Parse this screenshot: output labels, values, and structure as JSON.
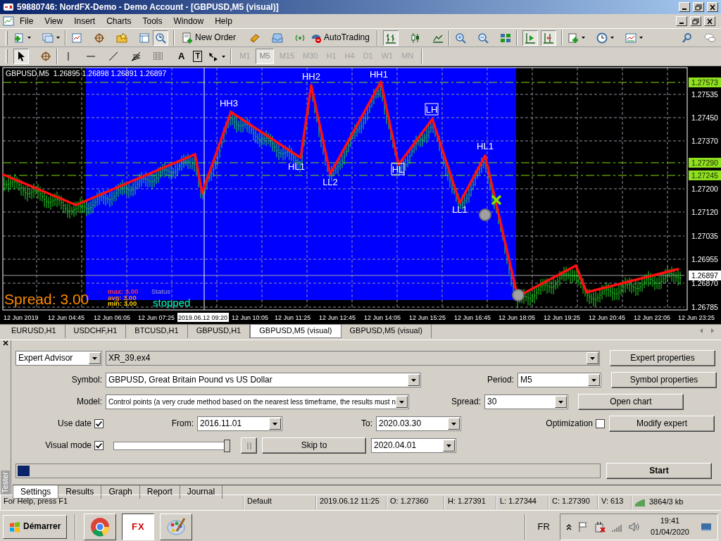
{
  "window": {
    "title": "59880746: NordFX-Demo - Demo Account - [GBPUSD,M5 (visual)]"
  },
  "menu": [
    "File",
    "View",
    "Insert",
    "Charts",
    "Tools",
    "Window",
    "Help"
  ],
  "toolbar": {
    "new_order": "New Order",
    "auto_trading": "AutoTrading"
  },
  "drawing_tools": {
    "text_tool": "A",
    "label_tool": "T"
  },
  "timeframes": [
    {
      "label": "M1",
      "selected": false
    },
    {
      "label": "M5",
      "selected": true
    },
    {
      "label": "M15",
      "selected": false
    },
    {
      "label": "M30",
      "selected": false
    },
    {
      "label": "H1",
      "selected": false
    },
    {
      "label": "H4",
      "selected": false
    },
    {
      "label": "D1",
      "selected": false
    },
    {
      "label": "W1",
      "selected": false
    },
    {
      "label": "MN",
      "selected": false
    }
  ],
  "chart": {
    "header": "GBPUSD,M5  1.26895 1.26898 1.26891 1.26897",
    "zigzag_labels": [
      {
        "text": "HH3",
        "boxed": false
      },
      {
        "text": "HH2",
        "boxed": false
      },
      {
        "text": "HH1",
        "boxed": false
      },
      {
        "text": "LH",
        "boxed": true
      },
      {
        "text": "HL1",
        "boxed": false
      },
      {
        "text": "LL2",
        "boxed": false
      },
      {
        "text": "HL",
        "boxed": true
      },
      {
        "text": "HL1",
        "boxed": false
      },
      {
        "text": "LL1",
        "boxed": false
      }
    ],
    "spread": "Spread: 3.00",
    "stats": [
      {
        "label": "max:",
        "value": "3.00",
        "color": "#ff3c3c"
      },
      {
        "label": "avg:",
        "value": "3.00",
        "color": "#ff8c00"
      },
      {
        "label": "min:",
        "value": "3.00",
        "color": "#ffd700"
      }
    ],
    "status_label": "Status",
    "status": "stopped",
    "price_labels": [
      {
        "text": "1.27573",
        "kind": "level"
      },
      {
        "text": "1.27535",
        "kind": "tick"
      },
      {
        "text": "1.27450",
        "kind": "tick"
      },
      {
        "text": "1.27370",
        "kind": "tick"
      },
      {
        "text": "1.27290",
        "kind": "level"
      },
      {
        "text": "1.27245",
        "kind": "level"
      },
      {
        "text": "1.27200",
        "kind": "tick"
      },
      {
        "text": "1.27120",
        "kind": "tick"
      },
      {
        "text": "1.27035",
        "kind": "tick"
      },
      {
        "text": "1.26955",
        "kind": "tick"
      },
      {
        "text": "1.26897",
        "kind": "bid"
      },
      {
        "text": "1.26870",
        "kind": "tick"
      },
      {
        "text": "1.26785",
        "kind": "tick"
      }
    ],
    "time_labels": [
      {
        "text": "12 Jun 2019",
        "kind": "tick"
      },
      {
        "text": "12 Jun 04:45",
        "kind": "tick"
      },
      {
        "text": "12 Jun 06:05",
        "kind": "tick"
      },
      {
        "text": "12 Jun 07:25",
        "kind": "tick"
      },
      {
        "text": "2019.06.12 09:20",
        "kind": "cursor"
      },
      {
        "text": "12 Jun 10:05",
        "kind": "tick"
      },
      {
        "text": "12 Jun 11:25",
        "kind": "tick"
      },
      {
        "text": "12 Jun 12:45",
        "kind": "tick"
      },
      {
        "text": "12 Jun 14:05",
        "kind": "tick"
      },
      {
        "text": "12 Jun 15:25",
        "kind": "tick"
      },
      {
        "text": "12 Jun 16:45",
        "kind": "tick"
      },
      {
        "text": "12 Jun 18:05",
        "kind": "tick"
      },
      {
        "text": "12 Jun 19:25",
        "kind": "tick"
      },
      {
        "text": "12 Jun 20:45",
        "kind": "tick"
      },
      {
        "text": "12 Jun 22:05",
        "kind": "tick"
      },
      {
        "text": "12 Jun 23:25",
        "kind": "tick"
      }
    ]
  },
  "chart_tabs": [
    {
      "label": "EURUSD,H1",
      "selected": false
    },
    {
      "label": "USDCHF,H1",
      "selected": false
    },
    {
      "label": "BTCUSD,H1",
      "selected": false
    },
    {
      "label": "GBPUSD,H1",
      "selected": false
    },
    {
      "label": "GBPUSD,M5 (visual)",
      "selected": true
    },
    {
      "label": "GBPUSD,M5 (visual)",
      "selected": false
    }
  ],
  "tester": {
    "title": "Tester",
    "type": "Expert Advisor",
    "expert": "XR_39.ex4",
    "symbol_label": "Symbol:",
    "symbol": "GBPUSD, Great Britain Pound vs US Dollar",
    "model_label": "Model:",
    "model": "Control points (a very crude method based on the nearest less timeframe, the results must n",
    "period_label": "Period:",
    "period": "M5",
    "spread_label": "Spread:",
    "spread": "30",
    "use_date": {
      "label": "Use date",
      "checked": true
    },
    "from_label": "From:",
    "from": "2016.11.01",
    "to_label": "To:",
    "to": "2020.03.30",
    "optimization": {
      "label": "Optimization",
      "checked": false
    },
    "visual_mode": {
      "label": "Visual mode",
      "checked": true
    },
    "speed": {
      "level": 1
    },
    "skip_button": "Skip to",
    "skip_date": "2020.04.01",
    "side_buttons": [
      "Expert properties",
      "Symbol properties",
      "Open chart",
      "Modify expert"
    ],
    "progress": {
      "level": 0.02
    },
    "start": "Start",
    "tabs": [
      {
        "label": "Settings",
        "selected": true
      },
      {
        "label": "Results",
        "selected": false
      },
      {
        "label": "Graph",
        "selected": false
      },
      {
        "label": "Report",
        "selected": false
      },
      {
        "label": "Journal",
        "selected": false
      }
    ]
  },
  "status_bar": [
    "For Help, press F1",
    "Default",
    "2019.06.12 11:25",
    "O: 1.27360",
    "H: 1.27391",
    "L: 1.27344",
    "C: 1.27390",
    "V: 613",
    "3864/3 kb"
  ],
  "taskbar": {
    "start": "Démarrer",
    "app_logo": "FX",
    "language": "FR",
    "time": "19:41",
    "date": "01/04/2020"
  }
}
